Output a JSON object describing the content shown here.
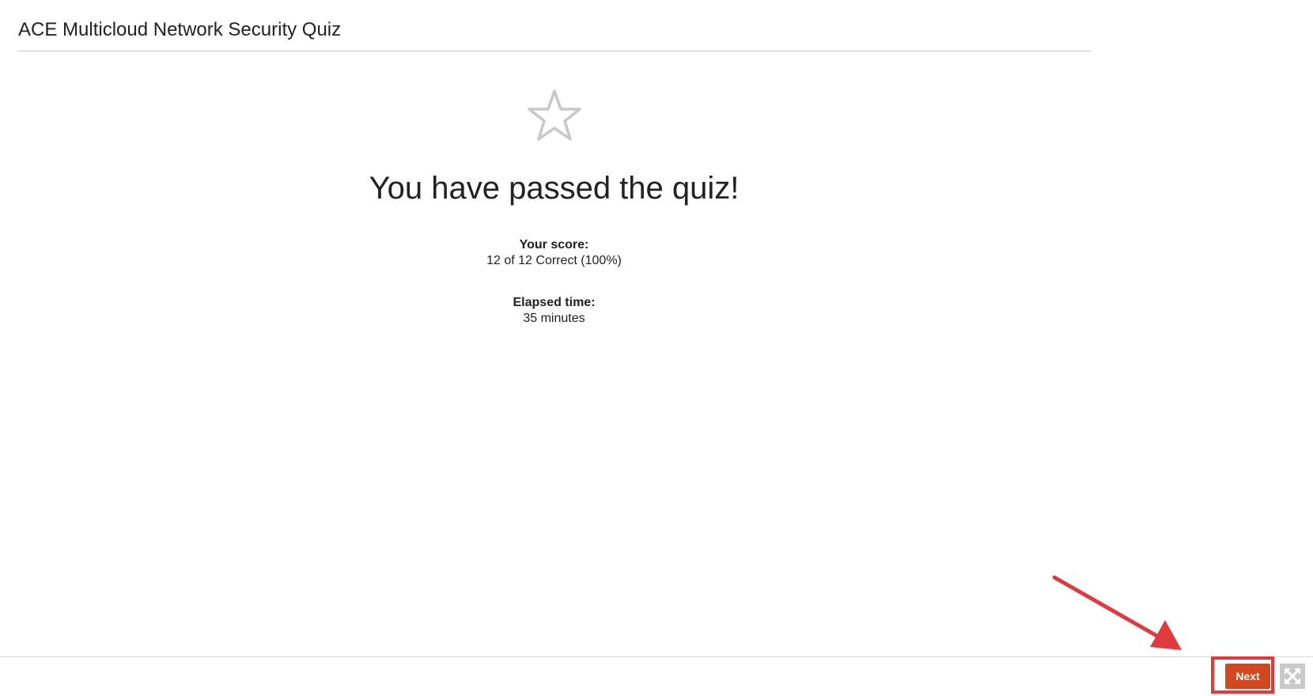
{
  "quiz": {
    "title": "ACE Multicloud Network Security Quiz"
  },
  "result": {
    "icon": "star-outline-icon",
    "heading": "You have passed the quiz!",
    "score_label": "Your score:",
    "score_value": "12 of 12 Correct (100%)",
    "elapsed_label": "Elapsed time:",
    "elapsed_value": "35 minutes"
  },
  "footer": {
    "next_label": "Next",
    "fullscreen_icon": "fullscreen-toggle-icon"
  },
  "colors": {
    "next_button": "#d3471e",
    "annotation": "#e03a3e",
    "star_outline": "#c8c8c8"
  }
}
